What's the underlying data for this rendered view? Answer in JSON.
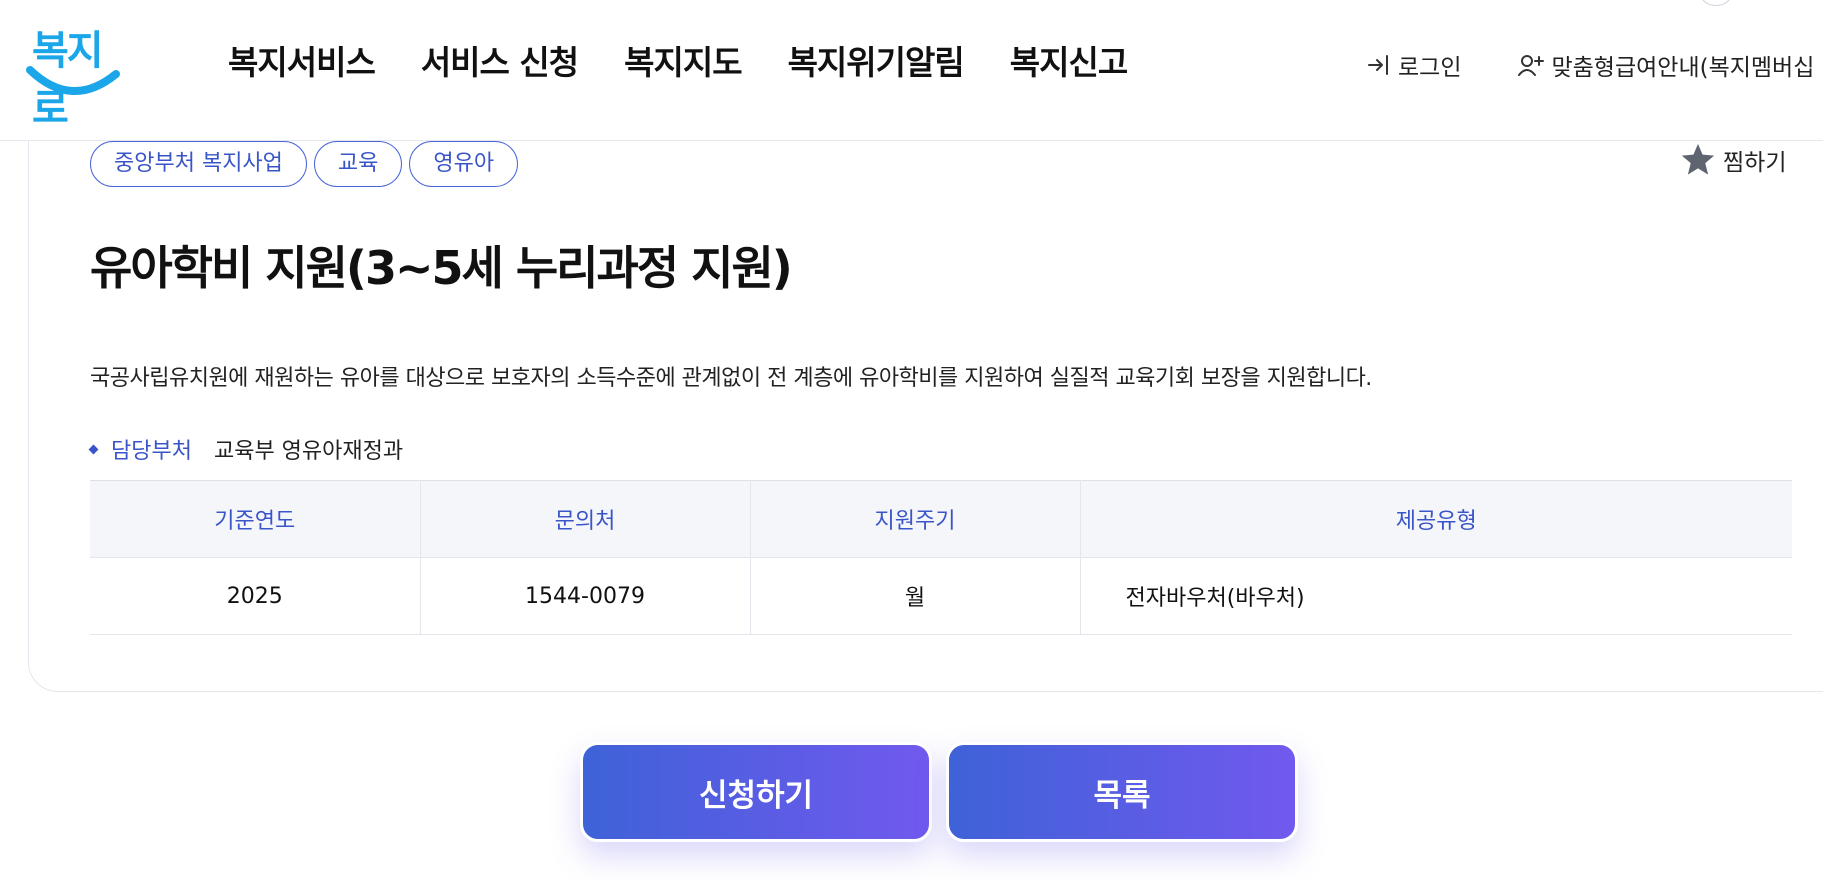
{
  "header": {
    "logo_text": "복지로",
    "nav": [
      "복지서비스",
      "서비스 신청",
      "복지지도",
      "복지위기알림",
      "복지신고"
    ],
    "login_label": "로그인",
    "custom_guide_label": "맞춤형급여안내(복지멤버십"
  },
  "service": {
    "tags": [
      "중앙부처 복지사업",
      "교육",
      "영유아"
    ],
    "favorite_label": "찜하기",
    "title": "유아학비 지원(3~5세 누리과정 지원)",
    "description": "국공사립유치원에 재원하는 유아를 대상으로 보호자의 소득수준에 관계없이 전 계층에 유아학비를 지원하여 실질적 교육기회 보장을 지원합니다.",
    "department_label": "담당부처",
    "department_value": "교육부 영유아재정과"
  },
  "table": {
    "headers": [
      "기준연도",
      "문의처",
      "지원주기",
      "제공유형"
    ],
    "row": [
      "2025",
      "1544-0079",
      "월",
      "전자바우처(바우처)"
    ]
  },
  "actions": {
    "apply_label": "신청하기",
    "list_label": "목록"
  },
  "colors": {
    "accent": "#3a55c9",
    "button_gradient_start": "#3e62d8",
    "button_gradient_end": "#7159ee",
    "logo_blue": "#1aa6e8",
    "star": "#5f6471"
  },
  "icons": {
    "login": "login-arrow-icon",
    "custom_guide": "user-plus-icon",
    "favorite": "star-icon"
  }
}
